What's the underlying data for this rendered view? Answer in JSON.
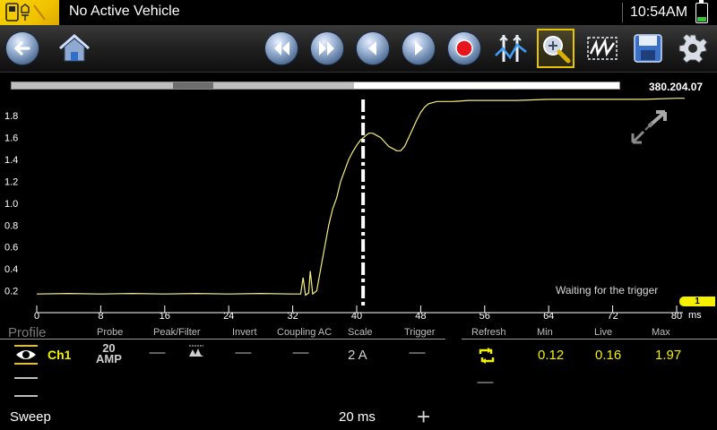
{
  "status": {
    "vehicle": "No Active Vehicle",
    "time": "10:54AM",
    "battery_icon": "battery-icon"
  },
  "toolbar": {
    "buttons": [
      {
        "name": "back-button",
        "icon": "back-arrow-icon"
      },
      {
        "name": "home-button",
        "icon": "home-icon"
      },
      {
        "name": "skip-back-button",
        "icon": "double-left-arrow-icon"
      },
      {
        "name": "skip-forward-button",
        "icon": "double-right-arrow-icon"
      },
      {
        "name": "step-back-button",
        "icon": "left-arrow-icon"
      },
      {
        "name": "step-forward-button",
        "icon": "right-arrow-icon"
      },
      {
        "name": "record-button",
        "icon": "record-icon"
      },
      {
        "name": "cursor-button",
        "icon": "cursor-icon"
      },
      {
        "name": "zoom-button",
        "icon": "zoom-icon",
        "selected": true
      },
      {
        "name": "trigger-button",
        "icon": "trigger-icon"
      },
      {
        "name": "save-button",
        "icon": "save-icon"
      },
      {
        "name": "settings-button",
        "icon": "gear-icon"
      }
    ]
  },
  "record_count": "380.204.07",
  "plot": {
    "waiting_text": "Waiting for the trigger",
    "channel_marker": "1",
    "x_unit": "ms",
    "x_ticks": [
      "0",
      "8",
      "16",
      "24",
      "32",
      "40",
      "48",
      "56",
      "64",
      "72",
      "80"
    ],
    "y_ticks": [
      "0.2",
      "0.4",
      "0.6",
      "0.8",
      "1.0",
      "1.2",
      "1.4",
      "1.6",
      "1.8"
    ],
    "trigger_ms": 40.8,
    "trace_color": "#f5f07a",
    "trace": [
      [
        0,
        0.17
      ],
      [
        4,
        0.175
      ],
      [
        8,
        0.17
      ],
      [
        12,
        0.175
      ],
      [
        16,
        0.17
      ],
      [
        20,
        0.175
      ],
      [
        24,
        0.17
      ],
      [
        28,
        0.175
      ],
      [
        32,
        0.17
      ],
      [
        33,
        0.17
      ],
      [
        33.3,
        0.32
      ],
      [
        33.6,
        0.16
      ],
      [
        34,
        0.18
      ],
      [
        34.2,
        0.38
      ],
      [
        34.5,
        0.17
      ],
      [
        35,
        0.2
      ],
      [
        35.5,
        0.4
      ],
      [
        36,
        0.6
      ],
      [
        36.5,
        0.8
      ],
      [
        37,
        0.95
      ],
      [
        37.5,
        1.05
      ],
      [
        38,
        1.2
      ],
      [
        38.5,
        1.3
      ],
      [
        39,
        1.4
      ],
      [
        39.5,
        1.47
      ],
      [
        40,
        1.53
      ],
      [
        40.5,
        1.58
      ],
      [
        41,
        1.61
      ],
      [
        41.5,
        1.64
      ],
      [
        42,
        1.64
      ],
      [
        42.5,
        1.62
      ],
      [
        43,
        1.6
      ],
      [
        43.5,
        1.56
      ],
      [
        44,
        1.52
      ],
      [
        44.5,
        1.5
      ],
      [
        45,
        1.48
      ],
      [
        45.5,
        1.48
      ],
      [
        46,
        1.52
      ],
      [
        46.5,
        1.6
      ],
      [
        47,
        1.68
      ],
      [
        47.5,
        1.76
      ],
      [
        48,
        1.83
      ],
      [
        48.5,
        1.88
      ],
      [
        49,
        1.91
      ],
      [
        50,
        1.93
      ],
      [
        52,
        1.93
      ],
      [
        54,
        1.94
      ],
      [
        56,
        1.94
      ],
      [
        60,
        1.94
      ],
      [
        64,
        1.95
      ],
      [
        68,
        1.95
      ],
      [
        72,
        1.95
      ],
      [
        76,
        1.95
      ],
      [
        80,
        1.96
      ],
      [
        81,
        1.96
      ]
    ]
  },
  "panel": {
    "profile_label": "Profile",
    "headers": {
      "probe": "Probe",
      "peak_filter": "Peak/Filter",
      "invert": "Invert",
      "coupling": "Coupling AC",
      "scale": "Scale",
      "trigger": "Trigger",
      "refresh": "Refresh",
      "min": "Min",
      "live": "Live",
      "max": "Max"
    },
    "channel": {
      "name": "Ch1",
      "probe_value": "20",
      "probe_unit": "AMP",
      "peak_filter": "------",
      "invert": "------",
      "coupling": "------",
      "scale": "2 A",
      "trigger": "------",
      "min": "0.12",
      "live": "0.16",
      "max": "1.97"
    },
    "refresh_second": "------",
    "sweep_label": "Sweep",
    "sweep_value": "20 ms",
    "plus": "+"
  }
}
